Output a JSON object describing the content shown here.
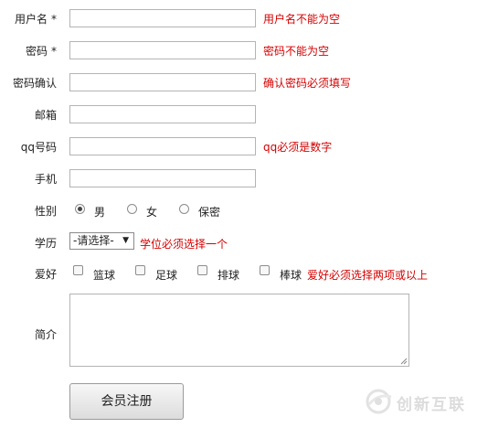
{
  "form": {
    "username": {
      "label": "用户名",
      "required_mark": "*",
      "value": "",
      "error": "用户名不能为空"
    },
    "password": {
      "label": "密码",
      "required_mark": "*",
      "value": "",
      "error": "密码不能为空"
    },
    "confirm": {
      "label": "密码确认",
      "value": "",
      "error": "确认密码必须填写"
    },
    "email": {
      "label": "邮箱",
      "value": ""
    },
    "qq": {
      "label": "qq号码",
      "value": "",
      "error": "qq必须是数字"
    },
    "phone": {
      "label": "手机",
      "value": ""
    },
    "gender": {
      "label": "性别",
      "options": [
        "男",
        "女",
        "保密"
      ],
      "selected": "男"
    },
    "degree": {
      "label": "学历",
      "selected": "-请选择-",
      "error": "学位必须选择一个"
    },
    "hobby": {
      "label": "爱好",
      "options": [
        "篮球",
        "足球",
        "排球",
        "棒球"
      ],
      "error": "爱好必须选择两项或以上"
    },
    "intro": {
      "label": "简介",
      "value": ""
    },
    "submit_label": "会员注册"
  },
  "watermark": {
    "text": "创新互联",
    "icon": "logo-icon"
  },
  "colors": {
    "error": "#d40000"
  }
}
